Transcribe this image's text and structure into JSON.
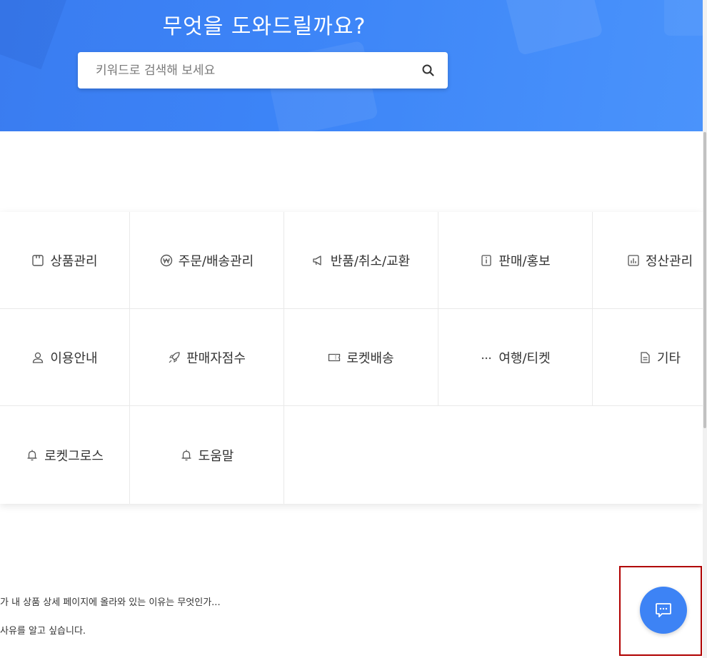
{
  "hero": {
    "title": "무엇을 도와드릴까요?",
    "search_placeholder": "키워드로 검색해 보세요",
    "search_icon": "search-icon",
    "accent": "#3c84f7"
  },
  "categories": [
    {
      "label": "상품관리",
      "icon": "product-box-icon"
    },
    {
      "label": "주문/배송관리",
      "icon": "won-coin-icon"
    },
    {
      "label": "반품/취소/교환",
      "icon": "megaphone-icon"
    },
    {
      "label": "판매/홍보",
      "icon": "info-card-icon"
    },
    {
      "label": "정산관리",
      "icon": "bar-chart-icon"
    },
    {
      "label": "이용안내",
      "icon": "person-icon"
    },
    {
      "label": "판매자점수",
      "icon": "rocket-icon"
    },
    {
      "label": "로켓배송",
      "icon": "ticket-icon"
    },
    {
      "label": "여행/티켓",
      "icon": "ellipsis-icon"
    },
    {
      "label": "기타",
      "icon": "document-icon"
    },
    {
      "label": "로켓그로스",
      "icon": "bell-icon"
    },
    {
      "label": "도움말",
      "icon": "bell-icon"
    }
  ],
  "faq": [
    "가 내 상품 상세 페이지에 올라와 있는 이유는 무엇인가...",
    "사유를 알고 싶습니다."
  ],
  "chat": {
    "icon": "chat-bubble-icon",
    "color": "#3d83f5"
  }
}
